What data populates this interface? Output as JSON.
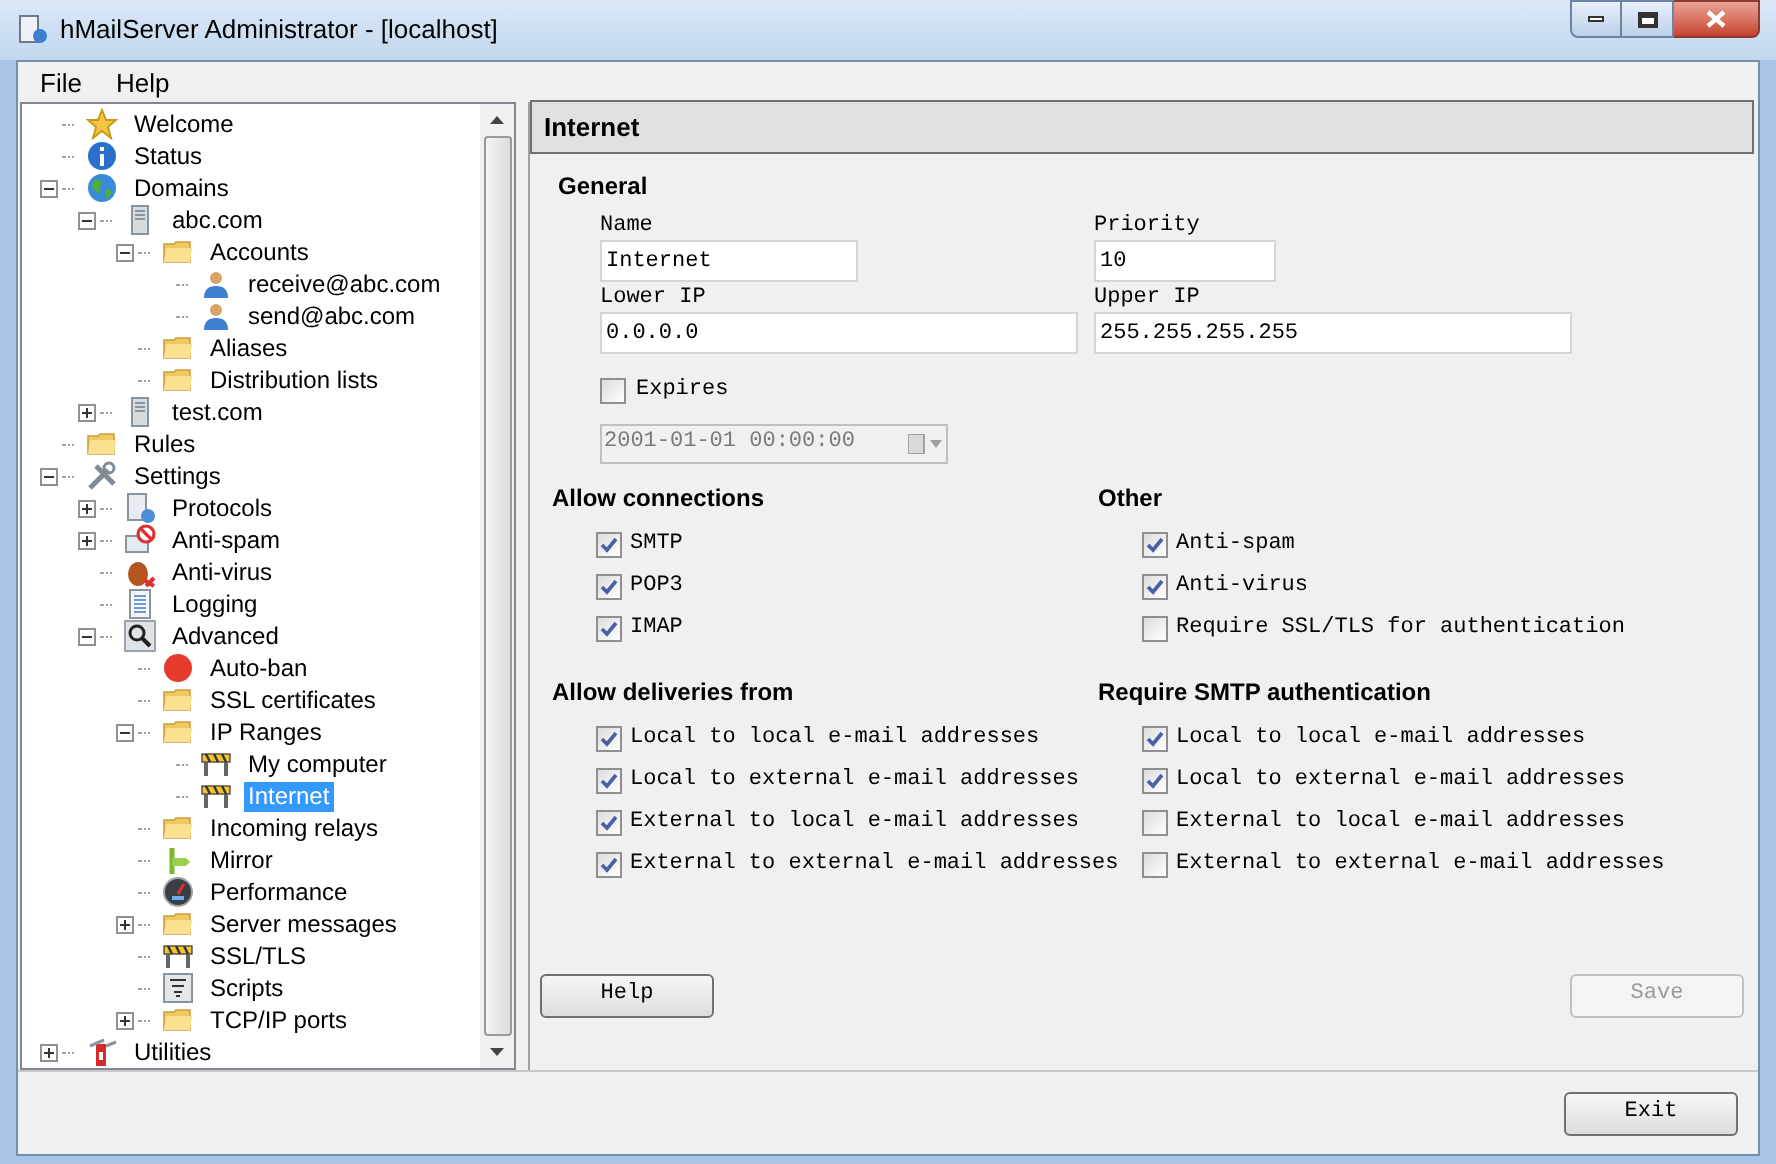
{
  "window": {
    "title": "hMailServer Administrator - [localhost]"
  },
  "menu": [
    "File",
    "Help"
  ],
  "tree": [
    {
      "label": "Welcome",
      "kind": "star",
      "selected": false
    },
    {
      "label": "Status",
      "kind": "info",
      "selected": false
    },
    {
      "label": "Domains",
      "kind": "globe",
      "selected": false,
      "expanded": true,
      "children": [
        {
          "label": "abc.com",
          "kind": "server",
          "selected": false,
          "expanded": true,
          "children": [
            {
              "label": "Accounts",
              "kind": "folder",
              "selected": false,
              "expanded": true,
              "children": [
                {
                  "label": "receive@abc.com",
                  "kind": "user",
                  "selected": false
                },
                {
                  "label": "send@abc.com",
                  "kind": "user",
                  "selected": false
                }
              ]
            },
            {
              "label": "Aliases",
              "kind": "folder",
              "selected": false
            },
            {
              "label": "Distribution lists",
              "kind": "folder",
              "selected": false
            }
          ]
        },
        {
          "label": "test.com",
          "kind": "server",
          "selected": false,
          "expanded": false
        }
      ]
    },
    {
      "label": "Rules",
      "kind": "folder",
      "selected": false
    },
    {
      "label": "Settings",
      "kind": "tools",
      "selected": false,
      "expanded": true,
      "children": [
        {
          "label": "Protocols",
          "kind": "document",
          "selected": false,
          "expanded": false
        },
        {
          "label": "Anti-spam",
          "kind": "nospam",
          "selected": false,
          "expanded": false
        },
        {
          "label": "Anti-virus",
          "kind": "bug",
          "selected": false
        },
        {
          "label": "Logging",
          "kind": "log",
          "selected": false
        },
        {
          "label": "Advanced",
          "kind": "magnifier",
          "selected": false,
          "expanded": true,
          "children": [
            {
              "label": "Auto-ban",
              "kind": "stop",
              "selected": false
            },
            {
              "label": "SSL certificates",
              "kind": "folder",
              "selected": false
            },
            {
              "label": "IP Ranges",
              "kind": "folder",
              "selected": false,
              "expanded": true,
              "children": [
                {
                  "label": "My computer",
                  "kind": "barrier",
                  "selected": false
                },
                {
                  "label": "Internet",
                  "kind": "barrier",
                  "selected": true
                }
              ]
            },
            {
              "label": "Incoming relays",
              "kind": "folder",
              "selected": false
            },
            {
              "label": "Mirror",
              "kind": "signpost",
              "selected": false
            },
            {
              "label": "Performance",
              "kind": "gauge",
              "selected": false
            },
            {
              "label": "Server messages",
              "kind": "folder",
              "selected": false,
              "expanded": false
            },
            {
              "label": "SSL/TLS",
              "kind": "barrier",
              "selected": false
            },
            {
              "label": "Scripts",
              "kind": "script",
              "selected": false
            },
            {
              "label": "TCP/IP ports",
              "kind": "folder",
              "selected": false,
              "expanded": false
            }
          ]
        }
      ]
    },
    {
      "label": "Utilities",
      "kind": "knife",
      "selected": false,
      "expanded": false
    }
  ],
  "panel": {
    "title": "Internet",
    "general": {
      "heading": "General",
      "name": {
        "label": "Name",
        "value": "Internet"
      },
      "priority": {
        "label": "Priority",
        "value": "10"
      },
      "lower_ip": {
        "label": "Lower IP",
        "value": "0.0.0.0"
      },
      "upper_ip": {
        "label": "Upper IP",
        "value": "255.255.255.255"
      },
      "expires": {
        "label": "Expires",
        "checked": false
      },
      "expiry_date": {
        "value": "2001-01-01 00:00:00",
        "disabled": true
      }
    },
    "allow_connections": {
      "heading": "Allow connections",
      "options": [
        {
          "label": "SMTP",
          "checked": true
        },
        {
          "label": "POP3",
          "checked": true
        },
        {
          "label": "IMAP",
          "checked": true
        }
      ]
    },
    "other": {
      "heading": "Other",
      "options": [
        {
          "label": "Anti-spam",
          "checked": true
        },
        {
          "label": "Anti-virus",
          "checked": true
        },
        {
          "label": "Require SSL/TLS for authentication",
          "checked": false
        }
      ]
    },
    "allow_deliveries": {
      "heading": "Allow deliveries from",
      "options": [
        {
          "label": "Local to local e-mail addresses",
          "checked": true
        },
        {
          "label": "Local to external e-mail addresses",
          "checked": true
        },
        {
          "label": "External to local e-mail addresses",
          "checked": true
        },
        {
          "label": "External to external e-mail addresses",
          "checked": true
        }
      ]
    },
    "require_auth": {
      "heading": "Require SMTP authentication",
      "options": [
        {
          "label": "Local to local e-mail addresses",
          "checked": true
        },
        {
          "label": "Local to external e-mail addresses",
          "checked": true
        },
        {
          "label": "External to local e-mail addresses",
          "checked": false
        },
        {
          "label": "External to external e-mail addresses",
          "checked": false
        }
      ]
    },
    "help_button": {
      "label": "Help",
      "disabled": false
    },
    "save_button": {
      "label": "Save",
      "disabled": true
    }
  },
  "exit_button": {
    "label": "Exit"
  }
}
